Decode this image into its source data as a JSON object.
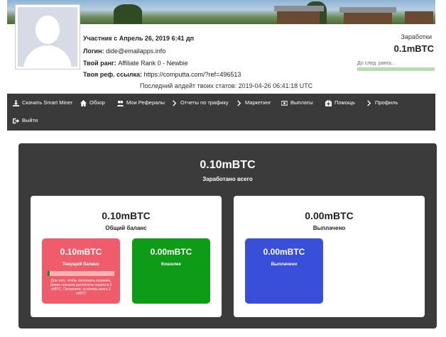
{
  "profile": {
    "member_since": "Участник с Апрель 26, 2019 6:41 дп",
    "login_label": "Логин:",
    "login_value": "dide@emailapps.info",
    "rank_label": "Твой ранг:",
    "rank_value": "Affiliate Rank 0 - Newbie",
    "ref_label": "Твоя реф. ссылка:",
    "ref_value": "https://computta.com/?ref=496513",
    "last_update": "Последний апдейт твоих статов: 2019-04-26 06:41:18 UTC",
    "earnings_label": "Заработки",
    "earnings_value": "0.1mBTC",
    "next_rank_label": "До след. ранга..."
  },
  "nav": {
    "items": [
      {
        "label": "Скачать Smart Miner",
        "icon": "download-icon"
      },
      {
        "label": "Обзор",
        "icon": "home-icon"
      },
      {
        "label": "Мои Рефералы",
        "icon": "users-icon"
      },
      {
        "label": "Отчеты по трафику",
        "icon": "chevron-right-icon"
      },
      {
        "label": "Маркетинг",
        "icon": "chevron-right-icon"
      },
      {
        "label": "Выплаты",
        "icon": "money-icon"
      },
      {
        "label": "Помощь",
        "icon": "medkit-icon"
      },
      {
        "label": "Профиль",
        "icon": "chevron-right-icon"
      },
      {
        "label": "Выйти",
        "icon": "logout-icon"
      }
    ]
  },
  "stats": {
    "total_value": "0.10mBTC",
    "total_label": "Заработано всего",
    "balance_card": {
      "value": "0.10mBTC",
      "label": "Общий баланс",
      "current": {
        "value": "0.10mBTC",
        "label": "Текущий баланс",
        "progress_percent": 3,
        "note": "Для того, чтобы пополнить кошелек, нужно сначала достигнуть порога в 3 mBTC. Потерпите, осталось всего 2 mBTC"
      },
      "wallet": {
        "value": "0.00mBTC",
        "label": "Кошелек"
      }
    },
    "paid_card": {
      "value": "0.00mBTC",
      "label": "Выплачено",
      "paid": {
        "value": "0.00mBTC",
        "label": "Выплачено"
      }
    }
  },
  "colors": {
    "nav_bg": "#3a3a3a",
    "panel_bg": "#3b3b3b",
    "current_box": "#ef5c6a",
    "wallet_box": "#0e9c16",
    "paid_box": "#3a4fd8",
    "progress_bar": "#b6ddb0"
  }
}
